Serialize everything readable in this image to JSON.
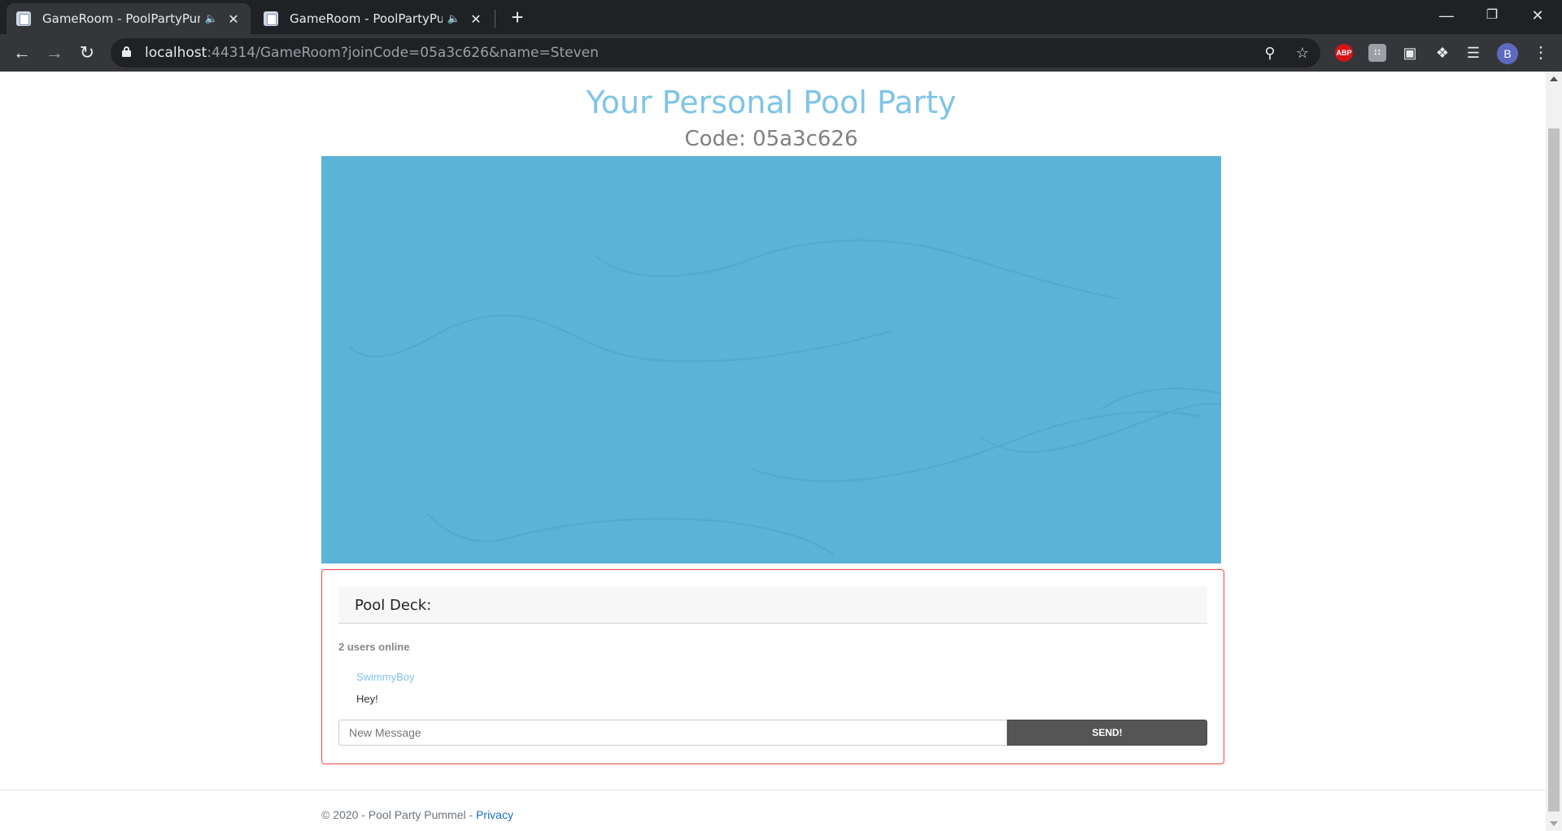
{
  "browser": {
    "tabs": [
      {
        "title": "GameRoom - PoolPartyPummel",
        "active": true
      },
      {
        "title": "GameRoom - PoolPartyPummel",
        "active": false
      }
    ],
    "url_host": "localhost",
    "url_rest": ":44314/GameRoom?joinCode=05a3c626&name=Steven",
    "profile_initial": "B",
    "extensions": {
      "abp_label": "ABP"
    }
  },
  "page": {
    "title": "Your Personal Pool Party",
    "code_label": "Code: 05a3c626"
  },
  "deck": {
    "header": "Pool Deck:",
    "online": "2 users online",
    "messages": [
      {
        "user": "SwimmyBoy",
        "text": "Hey!"
      }
    ],
    "input_placeholder": "New Message",
    "send_label": "SEND!"
  },
  "footer": {
    "text": "© 2020 - Pool Party Pummel - ",
    "privacy": "Privacy"
  },
  "colors": {
    "pool": "#5bb3d8",
    "title": "#7fc4e8",
    "deck_border": "#ee4444",
    "send_button": "#555555"
  }
}
